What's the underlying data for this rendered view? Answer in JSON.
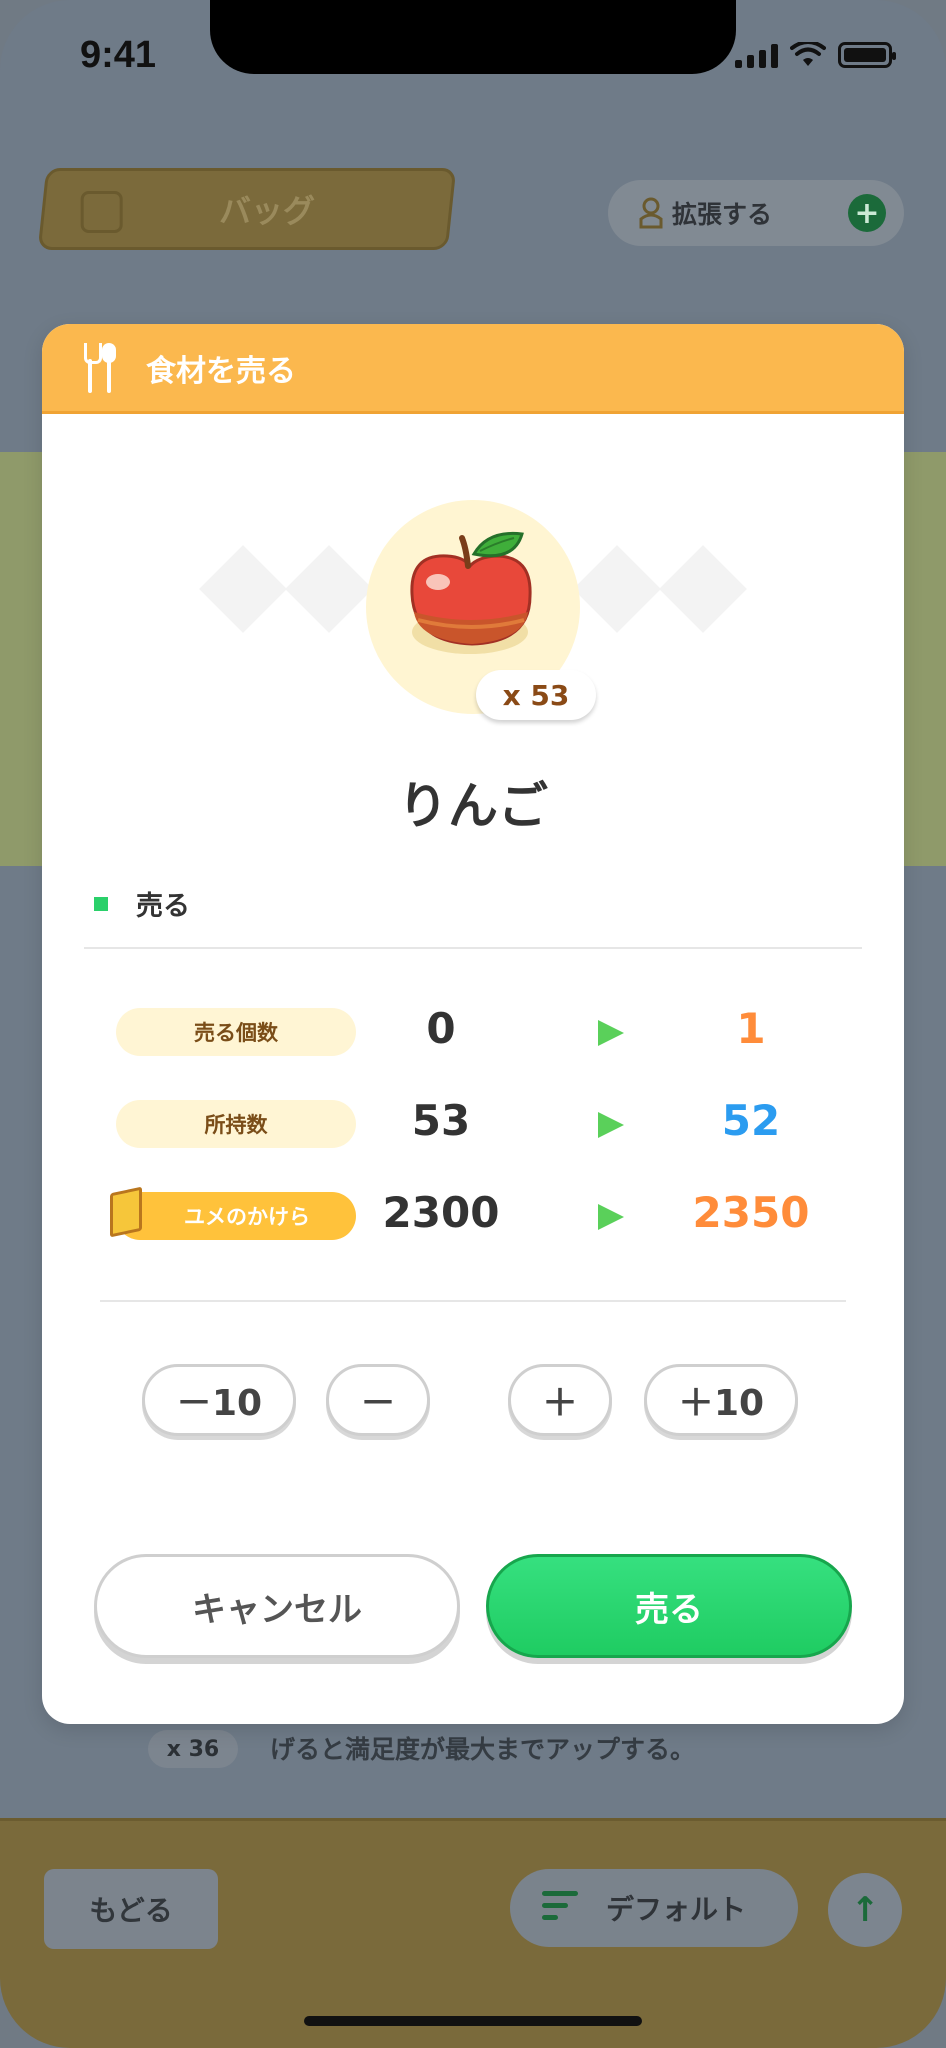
{
  "status_bar": {
    "time": "9:41"
  },
  "background": {
    "bag_tab_label": "バッグ",
    "expand_button_label": "拡張する",
    "expand_plus": "+",
    "item_count": "x 36",
    "item_description": "げると満足度が最大までアップする。",
    "back_button_label": "もどる",
    "sort_button_label": "デフォルト",
    "up_arrow": "↑"
  },
  "modal": {
    "title": "食材を売る",
    "item": {
      "name": "りんご",
      "quantity_label": "x 53",
      "icon": "apple-icon"
    },
    "section_label": "売る",
    "rows": [
      {
        "label": "売る個数",
        "from": "0",
        "to": "1",
        "to_color": "#ff8c3a"
      },
      {
        "label": "所持数",
        "from": "53",
        "to": "52",
        "to_color": "#2b9cf0"
      },
      {
        "label": "ユメのかけら",
        "from": "2300",
        "to": "2350",
        "to_color": "#ff8c3a"
      }
    ],
    "steppers": {
      "minus10": "－10",
      "minus": "－",
      "plus": "＋",
      "plus10": "＋10"
    },
    "cancel_label": "キャンセル",
    "sell_label": "売る"
  }
}
